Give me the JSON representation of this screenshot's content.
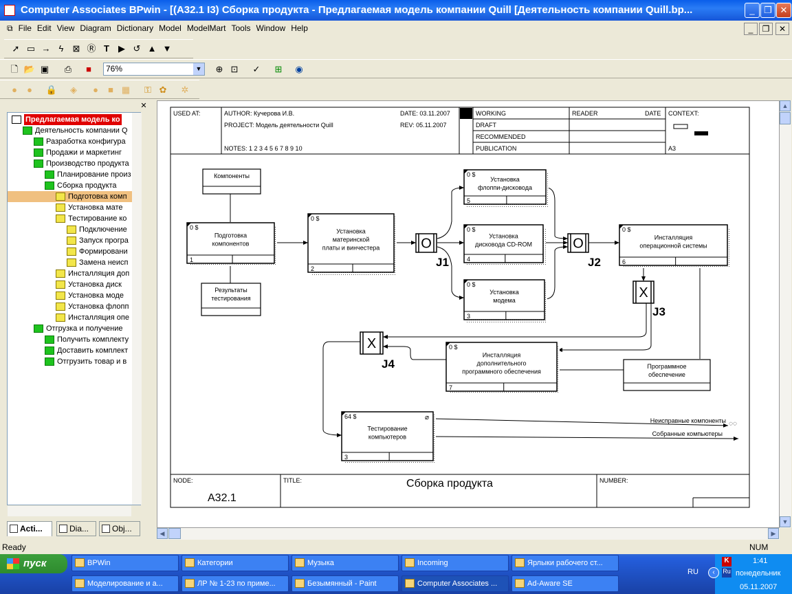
{
  "window": {
    "title": "Computer Associates BPwin - [(A32.1 I3) Сборка продукта - Предлагаемая модель компании Quill  [Деятельность компании Quill.bp...",
    "min": "_",
    "max": "❐",
    "close": "✕"
  },
  "menu": [
    "File",
    "Edit",
    "View",
    "Diagram",
    "Dictionary",
    "Model",
    "ModelMart",
    "Tools",
    "Window",
    "Help"
  ],
  "zoom": "76%",
  "tree": [
    {
      "label": "Предлагаемая модель ко",
      "level": 0,
      "icon": "root",
      "highlight": "red"
    },
    {
      "label": "Деятельность компании Q",
      "level": 1,
      "icon": "green"
    },
    {
      "label": "Разработка конфигура",
      "level": 2,
      "icon": "green"
    },
    {
      "label": "Продажи и маркетинг",
      "level": 2,
      "icon": "green"
    },
    {
      "label": "Производство продукта",
      "level": 2,
      "icon": "green"
    },
    {
      "label": "Планирование произ",
      "level": 3,
      "icon": "green"
    },
    {
      "label": "Сборка продукта",
      "level": 3,
      "icon": "green"
    },
    {
      "label": "Подготовка комп",
      "level": 4,
      "icon": "yellow",
      "selected": true
    },
    {
      "label": "Установка мате",
      "level": 4,
      "icon": "yellow"
    },
    {
      "label": "Тестирование ко",
      "level": 4,
      "icon": "yellow"
    },
    {
      "label": "Подключение",
      "level": 5,
      "icon": "yellow"
    },
    {
      "label": "Запуск програ",
      "level": 5,
      "icon": "yellow"
    },
    {
      "label": "Формировани",
      "level": 5,
      "icon": "yellow"
    },
    {
      "label": "Замена неисп",
      "level": 5,
      "icon": "yellow"
    },
    {
      "label": "Инсталляция доп",
      "level": 4,
      "icon": "yellow"
    },
    {
      "label": "Установка  диск",
      "level": 4,
      "icon": "yellow"
    },
    {
      "label": "Установка моде",
      "level": 4,
      "icon": "yellow"
    },
    {
      "label": "Установка флопп",
      "level": 4,
      "icon": "yellow"
    },
    {
      "label": "Инсталляция опе",
      "level": 4,
      "icon": "yellow"
    },
    {
      "label": "Отгрузка и получение",
      "level": 2,
      "icon": "green"
    },
    {
      "label": "Получить комплекту",
      "level": 3,
      "icon": "green"
    },
    {
      "label": "Доставить комплект",
      "level": 3,
      "icon": "green"
    },
    {
      "label": "Отгрузить товар и в",
      "level": 3,
      "icon": "green"
    }
  ],
  "tabs": [
    "Acti...",
    "Dia...",
    "Obj..."
  ],
  "frame": {
    "used_at": "USED AT:",
    "author": "AUTHOR:  Кучерова И.В.",
    "project": "PROJECT:  Модель деятельности Quill",
    "date": "DATE: 03.11.2007",
    "rev": "REV:   05.11.2007",
    "notes": "NOTES:  1  2  3  4  5  6  7  8  9  10",
    "working": "WORKING",
    "draft": "DRAFT",
    "recommended": "RECOMMENDED",
    "publication": "PUBLICATION",
    "reader": "READER",
    "reader_date": "DATE",
    "context": "CONTEXT:",
    "context_node": "A3",
    "node_label": "NODE:",
    "node": "A32.1",
    "title_label": "TITLE:",
    "title": "Сборка продукта",
    "number_label": "NUMBER:"
  },
  "diagram": {
    "boxes": [
      {
        "id": "b1",
        "cost": "0 $",
        "num": "1",
        "lines": [
          "Подготовка",
          "компонентов"
        ]
      },
      {
        "id": "b2",
        "cost": "0 $",
        "num": "2",
        "lines": [
          "Установка",
          "материнской",
          "платы и винчестера"
        ]
      },
      {
        "id": "b5",
        "cost": "0 $",
        "num": "5",
        "lines": [
          "Установка",
          "флоппи-дисковода"
        ]
      },
      {
        "id": "b4",
        "cost": "0 $",
        "num": "4",
        "lines": [
          "Установка",
          "дисковода CD-ROM"
        ]
      },
      {
        "id": "b3a",
        "cost": "0 $",
        "num": "3",
        "lines": [
          "Установка",
          "модема"
        ]
      },
      {
        "id": "b6",
        "cost": "0 $",
        "num": "6",
        "lines": [
          "Инсталляция",
          "операционной системы"
        ]
      },
      {
        "id": "b7",
        "cost": "0 $",
        "num": "7",
        "lines": [
          "Инсталляция",
          "дополнительного",
          "программного обеспечения"
        ]
      },
      {
        "id": "b3",
        "cost": "64 $",
        "num": "3",
        "lines": [
          "Тестирование",
          "компьютеров"
        ]
      }
    ],
    "refs": [
      {
        "id": "r1",
        "lines": [
          "Компоненты"
        ]
      },
      {
        "id": "r2",
        "lines": [
          "Результаты",
          "тестирования"
        ]
      },
      {
        "id": "r3",
        "lines": [
          "Программное",
          "обеспечение"
        ]
      }
    ],
    "junctions": [
      {
        "id": "j1",
        "sym": "O",
        "label": "J1"
      },
      {
        "id": "j2",
        "sym": "O",
        "label": "J2"
      },
      {
        "id": "j3",
        "sym": "X",
        "label": "J3"
      },
      {
        "id": "j4",
        "sym": "X",
        "label": "J4"
      }
    ],
    "outputs": [
      "Неисправные компоненты",
      "Собранные компьютеры"
    ]
  },
  "status": {
    "text": "Ready",
    "num": "NUM"
  },
  "taskbar": {
    "start": "пуск",
    "row1": [
      "BPWin",
      "Категории",
      "Музыка",
      "Incoming",
      "Ярлыки рабочего ст..."
    ],
    "row2": [
      "Моделирование и а...",
      "ЛР № 1-23 по приме...",
      "Безымянный - Paint",
      "Computer Associates ...",
      "Ad-Aware SE"
    ],
    "lang": "RU",
    "time": "1:41",
    "day": "понедельник",
    "date": "05.11.2007"
  }
}
